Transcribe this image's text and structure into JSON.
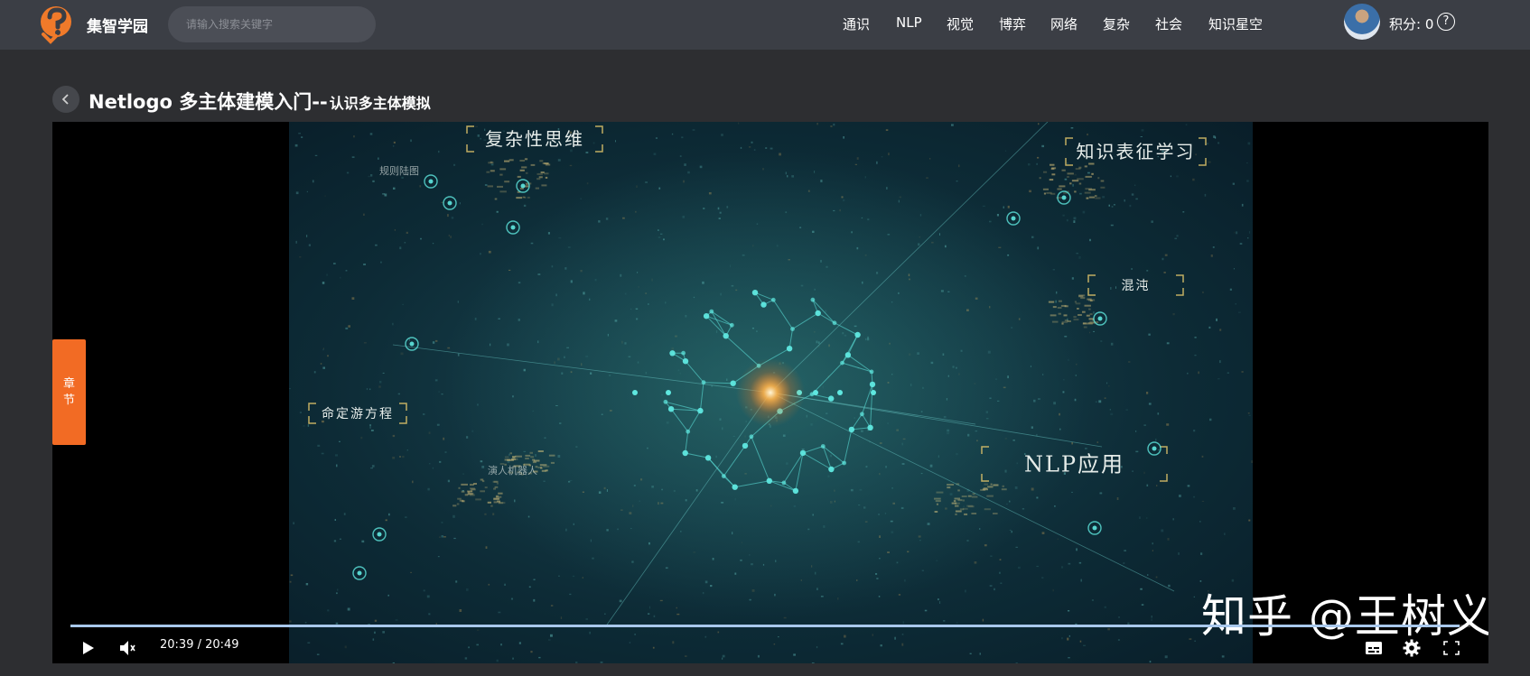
{
  "header": {
    "brand": "集智学园",
    "search_placeholder": "请输入搜索关键字",
    "nav": [
      "通识",
      "NLP",
      "视觉",
      "博弈",
      "网络",
      "复杂",
      "社会",
      "知识星空"
    ],
    "points_label": "积分: 0",
    "help_glyph": "?"
  },
  "page": {
    "title_main": "Netlogo 多主体建模入门--",
    "title_sub": "认识多主体模拟"
  },
  "player": {
    "chapter_tab": [
      "章",
      "节"
    ],
    "time_display": "20:39 / 20:49",
    "progress": 0.992,
    "watermark": "知乎 @王树义"
  },
  "video": {
    "labels": [
      {
        "text": "复杂性思维"
      },
      {
        "text": "知识表征学习"
      },
      {
        "text": "混沌"
      },
      {
        "text": "NLP应用"
      },
      {
        "text": "命定游方程"
      }
    ],
    "faint_labels": [
      "规则陆图",
      "演人机器人"
    ],
    "accent": "#5fe8e0",
    "core_glow": "#ffb24a"
  },
  "colors": {
    "topbar": "#3b3e45",
    "chapter_tab": "#f26b24",
    "progress": "#a9c8ec"
  }
}
